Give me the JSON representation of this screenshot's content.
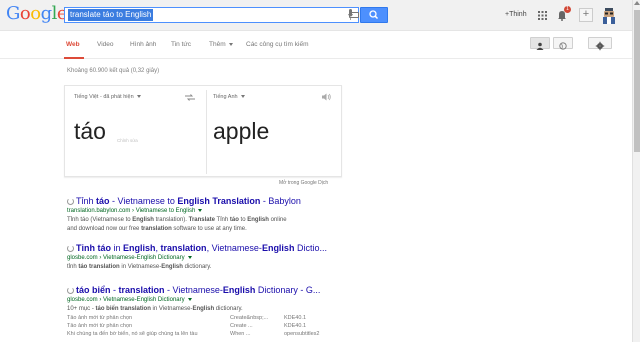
{
  "header": {
    "logo": "Google",
    "logo_colors": [
      "#4285f4",
      "#ea4335",
      "#fbbc05",
      "#4285f4",
      "#34a853",
      "#ea4335"
    ],
    "query": "translate táo to English",
    "user_name": "+Thinh",
    "notification_count": "1"
  },
  "nav": {
    "tabs": [
      "Web",
      "Video",
      "Hình ảnh",
      "Tin tức",
      "Thêm",
      "Các công cụ tìm kiếm"
    ]
  },
  "stats": "Khoảng 60.900 kết quả (0,32 giây)",
  "translate": {
    "source_lang": "Tiếng Việt - đã phát hiện",
    "target_lang": "Tiếng Anh",
    "source_text": "táo",
    "edit_label": "Chỉnh sửa",
    "target_text": "apple",
    "open_link": "Mở trong Google Dịch"
  },
  "results": [
    {
      "title_parts": [
        "Tỉnh ",
        "táo",
        " - Vietnamese to ",
        "English Translation",
        " - Babylon"
      ],
      "url": "translation.babylon.com › Vietnamese to English",
      "snippet1_parts": [
        "Tỉnh táo (Vietnamese to ",
        "English",
        " translation). ",
        "Translate",
        " Tỉnh ",
        "táo",
        " to ",
        "English",
        " online"
      ],
      "snippet2_parts": [
        "and download now our free ",
        "translation",
        " software to use at any time."
      ]
    },
    {
      "title_parts": [
        "Tỉnh táo",
        " in ",
        "English",
        ", ",
        "translation",
        ", Vietnamese-",
        "English",
        " Dictio..."
      ],
      "url": "glosbe.com › Vietnamese-English Dictionary",
      "snippet1_parts": [
        "tỉnh ",
        "táo",
        " translation",
        " in Vietnamese-",
        "English",
        " dictionary."
      ]
    },
    {
      "title_parts": [
        "táo biển",
        " - ",
        "translation",
        " - Vietnamese-",
        "English",
        " Dictionary - G..."
      ],
      "url": "glosbe.com › Vietnamese-English Dictionary",
      "snippet1_parts": [
        "10+ mục - ",
        "táo biển",
        " translation",
        " in Vietnamese-",
        "English",
        " dictionary."
      ],
      "table": [
        [
          "Tảo ảnh mới từ phản chọn",
          "Create&nbsp;...",
          "KDE40.1"
        ],
        [
          "Tảo ảnh mới từ phản chọn",
          "Create ...",
          "KDE40.1"
        ],
        [
          "Khi chúng ta đến bờ biển, nó sẽ giúp chúng ta lên tàu",
          "When ...",
          "opensubtitles2"
        ]
      ]
    }
  ]
}
